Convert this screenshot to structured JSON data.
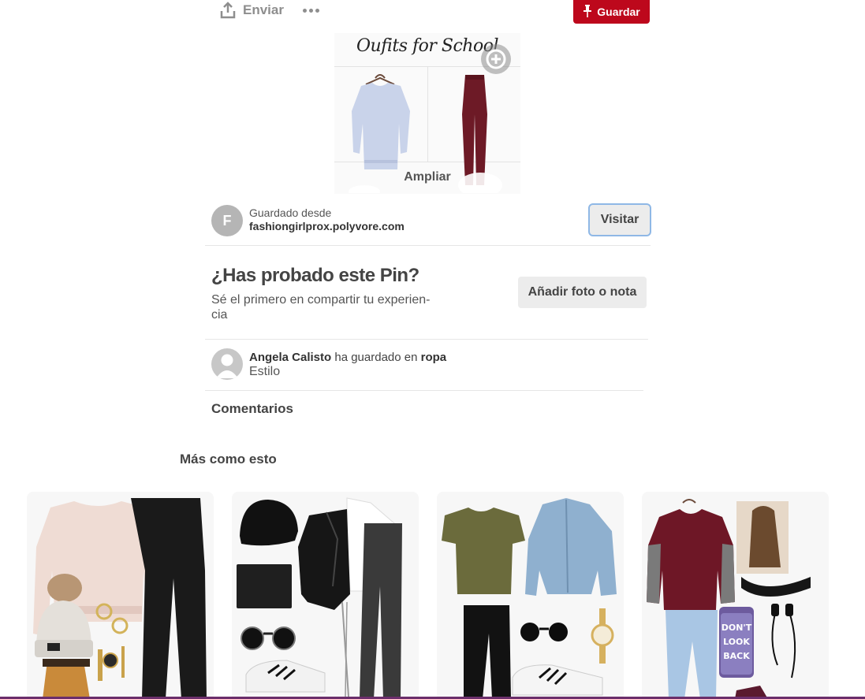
{
  "topbar": {
    "send_label": "Enviar",
    "save_label": "Guardar"
  },
  "pin": {
    "image_title": "Oufits for School",
    "expand_label": "Ampliar"
  },
  "source": {
    "avatar_letter": "F",
    "label": "Guardado desde",
    "domain": "fashiongirlprox.polyvore.com",
    "visit_label": "Visitar"
  },
  "tried": {
    "title": "¿Has probado este Pin?",
    "subtitle": "Sé el primero en compartir tu experien-cia",
    "add_label": "Añadir foto o nota"
  },
  "saver": {
    "name": "Angela Calisto",
    "action": "ha guardado en",
    "board": "ropa",
    "description": "Estilo"
  },
  "comments_label": "Comentarios",
  "more_like_label": "Más como esto",
  "colors": {
    "save_red": "#bd081c",
    "visit_border": "#8fb8e6",
    "button_gray": "#ececec"
  },
  "grid": [
    {
      "name": "outfit-card-1",
      "subject": "pink sweater, black leggings, beanie, boots"
    },
    {
      "name": "outfit-card-2",
      "subject": "black beanie, leather jacket, white tee, jeans"
    },
    {
      "name": "outfit-card-3",
      "subject": "olive tee, denim shirt, sunglasses, sneakers"
    },
    {
      "name": "outfit-card-4",
      "subject": "burgundy sweater, choker, jeans, phone case"
    }
  ],
  "grid_text": {
    "phone_case_text": "DON'T LOOK BACK"
  }
}
